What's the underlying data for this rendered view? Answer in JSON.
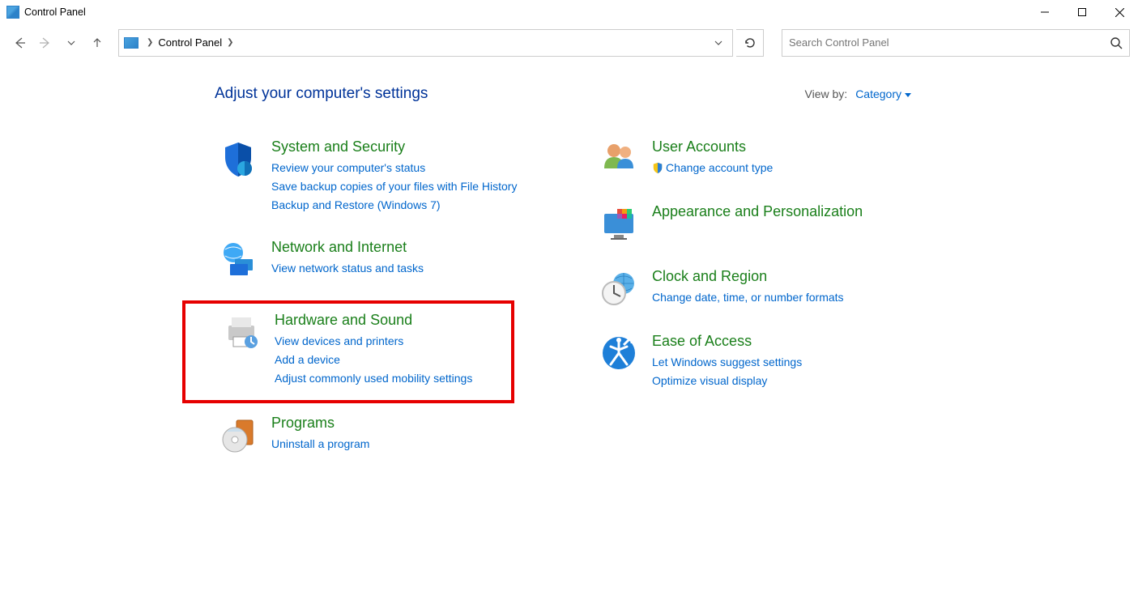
{
  "window": {
    "title": "Control Panel"
  },
  "breadcrumb": {
    "root": "Control Panel"
  },
  "search": {
    "placeholder": "Search Control Panel"
  },
  "header": {
    "title": "Adjust your computer's settings",
    "viewby_label": "View by:",
    "viewby_value": "Category"
  },
  "categories": {
    "left": [
      {
        "id": "system-security",
        "title": "System and Security",
        "links": [
          "Review your computer's status",
          "Save backup copies of your files with File History",
          "Backup and Restore (Windows 7)"
        ]
      },
      {
        "id": "network-internet",
        "title": "Network and Internet",
        "links": [
          "View network status and tasks"
        ]
      },
      {
        "id": "hardware-sound",
        "title": "Hardware and Sound",
        "highlighted": true,
        "links": [
          "View devices and printers",
          "Add a device",
          "Adjust commonly used mobility settings"
        ]
      },
      {
        "id": "programs",
        "title": "Programs",
        "links": [
          "Uninstall a program"
        ]
      }
    ],
    "right": [
      {
        "id": "user-accounts",
        "title": "User Accounts",
        "links_shield": [
          "Change account type"
        ]
      },
      {
        "id": "appearance",
        "title": "Appearance and Personalization",
        "links": []
      },
      {
        "id": "clock-region",
        "title": "Clock and Region",
        "links": [
          "Change date, time, or number formats"
        ]
      },
      {
        "id": "ease-of-access",
        "title": "Ease of Access",
        "links": [
          "Let Windows suggest settings",
          "Optimize visual display"
        ]
      }
    ]
  }
}
